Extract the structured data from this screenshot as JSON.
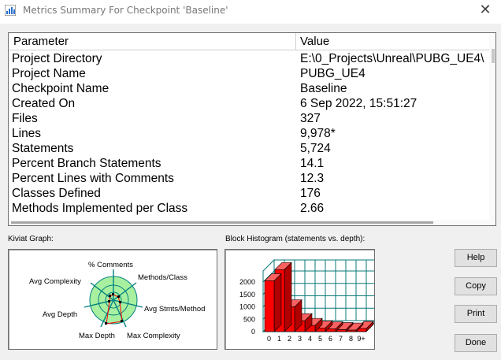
{
  "window": {
    "title": "Metrics Summary For Checkpoint 'Baseline'",
    "close_glyph": "✕"
  },
  "table": {
    "columns": [
      "Parameter",
      "Value"
    ],
    "rows": [
      {
        "param": "Project Directory",
        "value": "E:\\0_Projects\\Unreal\\PUBG_UE4\\"
      },
      {
        "param": "Project Name",
        "value": "PUBG_UE4"
      },
      {
        "param": "Checkpoint Name",
        "value": "Baseline"
      },
      {
        "param": "Created On",
        "value": "6 Sep 2022, 15:51:27"
      },
      {
        "param": "Files",
        "value": "327"
      },
      {
        "param": "Lines",
        "value": "9,978*"
      },
      {
        "param": "Statements",
        "value": "5,724"
      },
      {
        "param": "Percent Branch Statements",
        "value": "14.1"
      },
      {
        "param": "Percent Lines with Comments",
        "value": "12.3"
      },
      {
        "param": "Classes Defined",
        "value": "176"
      },
      {
        "param": "Methods Implemented per Class",
        "value": "2.66"
      }
    ]
  },
  "kiviat": {
    "label": "Kiviat Graph:",
    "axes": [
      "% Comments",
      "Methods/Class",
      "Avg Stmts/Method",
      "Max Complexity",
      "Max Depth",
      "Avg Depth",
      "Avg Complexity"
    ]
  },
  "histogram": {
    "label": "Block Histogram (statements vs. depth):",
    "y_ticks": [
      "2000",
      "1500",
      "1000",
      "500",
      "0"
    ],
    "categories": [
      "0",
      "1",
      "2",
      "3",
      "4",
      "5",
      "6",
      "7",
      "8",
      "9+"
    ]
  },
  "chart_data": {
    "type": "bar",
    "title": "Block Histogram (statements vs. depth):",
    "categories": [
      "0",
      "1",
      "2",
      "3",
      "4",
      "5",
      "6",
      "7",
      "8",
      "9+"
    ],
    "values": [
      2050,
      2520,
      1000,
      440,
      250,
      150,
      110,
      80,
      60,
      130
    ],
    "ylim": [
      0,
      2000
    ],
    "colors": {
      "bar": "#ff0000",
      "grid": "#0b7878"
    }
  },
  "buttons": {
    "help": "Help",
    "copy": "Copy",
    "print": "Print",
    "done": "Done"
  },
  "colors": {
    "kiviat_fill": "#a8f0a0",
    "kiviat_axis": "#008080",
    "kiviat_poly": "#ff0000"
  }
}
